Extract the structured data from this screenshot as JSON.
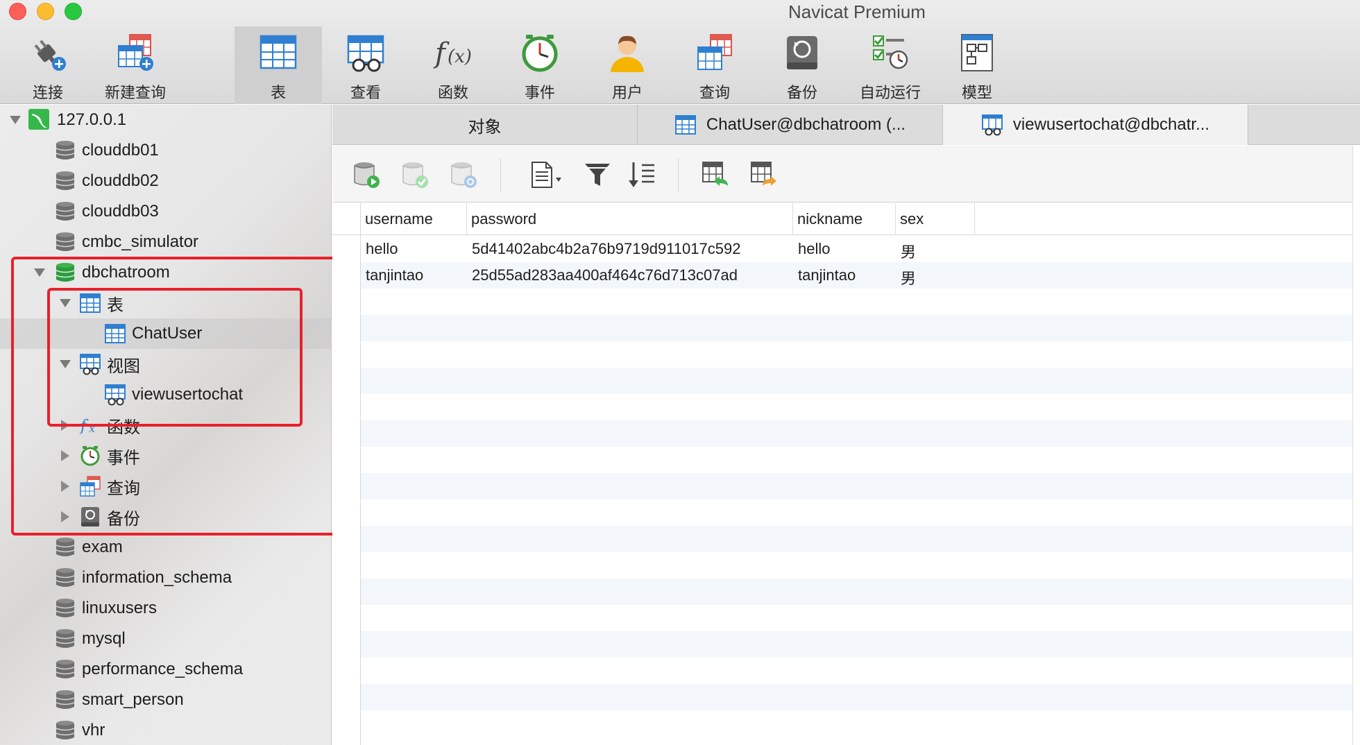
{
  "window": {
    "title": "Navicat Premium"
  },
  "toolbar": {
    "items": [
      {
        "label": "连接",
        "icon": "plug-icon"
      },
      {
        "label": "新建查询",
        "icon": "new-query-icon"
      },
      {
        "label": "表",
        "icon": "table-icon",
        "active": true
      },
      {
        "label": "查看",
        "icon": "view-icon"
      },
      {
        "label": "函数",
        "icon": "function-icon"
      },
      {
        "label": "事件",
        "icon": "clock-icon"
      },
      {
        "label": "用户",
        "icon": "user-icon"
      },
      {
        "label": "查询",
        "icon": "query-icon"
      },
      {
        "label": "备份",
        "icon": "backup-icon"
      },
      {
        "label": "自动运行",
        "icon": "automation-icon"
      },
      {
        "label": "模型",
        "icon": "model-icon"
      }
    ]
  },
  "sidebar": {
    "connection": "127.0.0.1",
    "databases_before": [
      "clouddb01",
      "clouddb02",
      "clouddb03",
      "cmbc_simulator"
    ],
    "open_database": "dbchatroom",
    "groups": {
      "tables": "表",
      "table_item": "ChatUser",
      "views": "视图",
      "view_item": "viewusertochat",
      "functions": "函数",
      "events": "事件",
      "queries": "查询",
      "backups": "备份"
    },
    "databases_after": [
      "exam",
      "information_schema",
      "linuxusers",
      "mysql",
      "performance_schema",
      "smart_person",
      "vhr"
    ]
  },
  "tabs": [
    {
      "label": "对象"
    },
    {
      "label": "ChatUser@dbchatroom (..."
    },
    {
      "label": "viewusertochat@dbchatr...",
      "active": true
    }
  ],
  "grid": {
    "columns": [
      "username",
      "password",
      "nickname",
      "sex"
    ],
    "rows": [
      [
        "hello",
        "5d41402abc4b2a76b9719d911017c592",
        "hello",
        "男"
      ],
      [
        "tanjintao",
        "25d55ad283aa400af464c76d713c07ad",
        "tanjintao",
        "男"
      ]
    ]
  },
  "colors": {
    "highlight": "#e8202a",
    "accent_blue": "#2f7fd1"
  }
}
